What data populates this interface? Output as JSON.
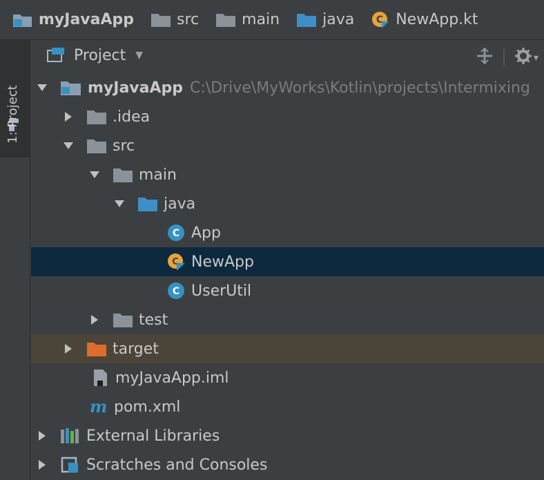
{
  "breadcrumb": {
    "items": [
      {
        "label": "myJavaApp",
        "icon": "module-folder-icon"
      },
      {
        "label": "src",
        "icon": "folder-icon"
      },
      {
        "label": "main",
        "icon": "folder-icon"
      },
      {
        "label": "java",
        "icon": "source-folder-icon"
      },
      {
        "label": "NewApp.kt",
        "icon": "kotlin-file-icon"
      }
    ]
  },
  "stripe": {
    "project_tab": "1: Project"
  },
  "tool_window": {
    "title": "Project",
    "icons": [
      "project-view-icon",
      "dropdown-caret-icon",
      "collapse-all-icon",
      "gear-icon"
    ]
  },
  "tree": {
    "root": {
      "name": "myJavaApp",
      "path": "C:\\Drive\\MyWorks\\Kotlin\\projects\\Intermixing"
    },
    "idea": ".idea",
    "src": "src",
    "main": "main",
    "java": "java",
    "app": "App",
    "newapp": "NewApp",
    "userutil": "UserUtil",
    "test": "test",
    "target": "target",
    "iml": "myJavaApp.iml",
    "pom": "pom.xml",
    "ext_libs": "External Libraries",
    "scratches": "Scratches and Consoles",
    "selected_item": "NewApp"
  },
  "colors": {
    "background": "#3c3f41",
    "selection": "#0d293e",
    "excluded_row": "#4b4539",
    "class_icon": "#3592c4",
    "kotlin_icon": "#e8a33d",
    "excluded_folder": "#e06c2b"
  }
}
